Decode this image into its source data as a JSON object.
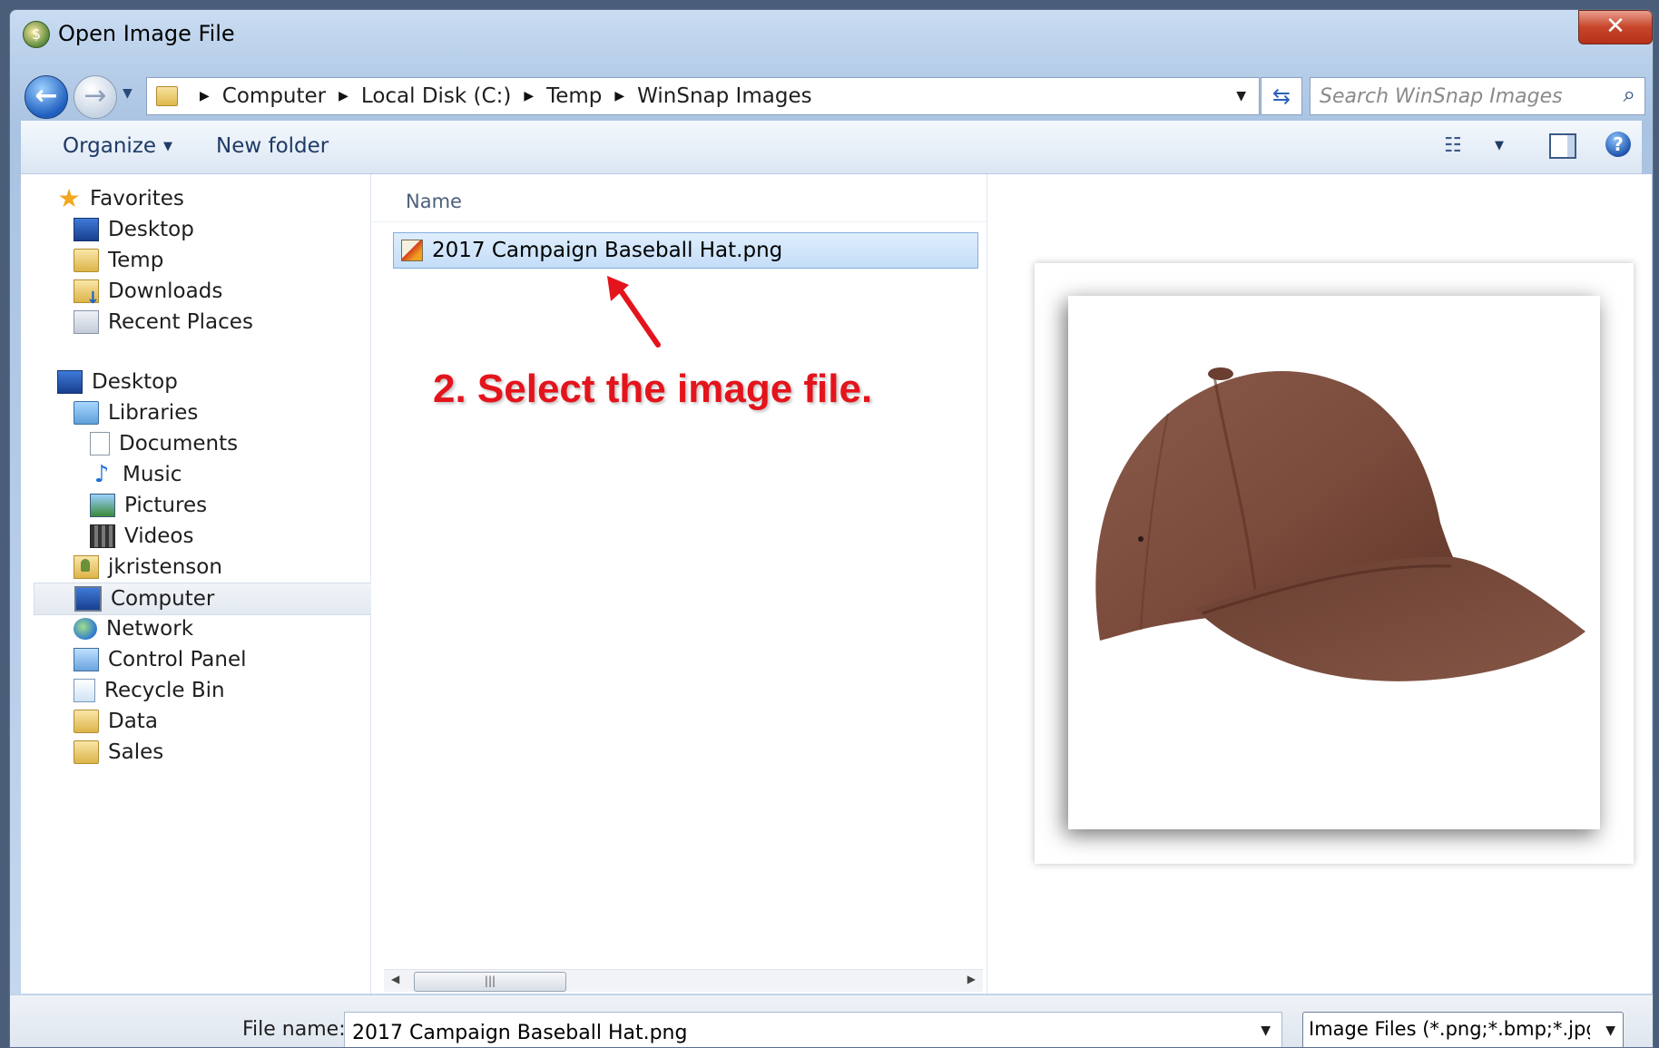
{
  "window": {
    "title": "Open Image File"
  },
  "address_bar": {
    "crumbs": [
      "Computer",
      "Local Disk (C:)",
      "Temp",
      "WinSnap Images"
    ]
  },
  "search": {
    "placeholder": "Search WinSnap Images"
  },
  "toolbar": {
    "organize_label": "Organize",
    "new_folder_label": "New folder"
  },
  "nav": {
    "favorites_header": "Favorites",
    "favorites": [
      "Desktop",
      "Temp",
      "Downloads",
      "Recent Places"
    ],
    "desktop_header": "Desktop",
    "libraries_label": "Libraries",
    "libraries": [
      "Documents",
      "Music",
      "Pictures",
      "Videos"
    ],
    "others": [
      "jkristenson",
      "Computer",
      "Network",
      "Control Panel",
      "Recycle Bin",
      "Data",
      "Sales"
    ],
    "selected": "Computer"
  },
  "file_list": {
    "column_header": "Name",
    "files": [
      {
        "name": "2017 Campaign Baseball Hat.png",
        "selected": true
      }
    ]
  },
  "annotation": {
    "text": "2. Select the image file.",
    "color": "#e4141c"
  },
  "bottom": {
    "file_name_label": "File name:",
    "file_name_value": "2017 Campaign Baseball Hat.png",
    "file_type_filter": "Image Files (*.png;*.bmp;*.jpg;*"
  },
  "colors": {
    "accent": "#2a62b8",
    "selection": "#c4ddf8",
    "close_button": "#c8462b"
  }
}
